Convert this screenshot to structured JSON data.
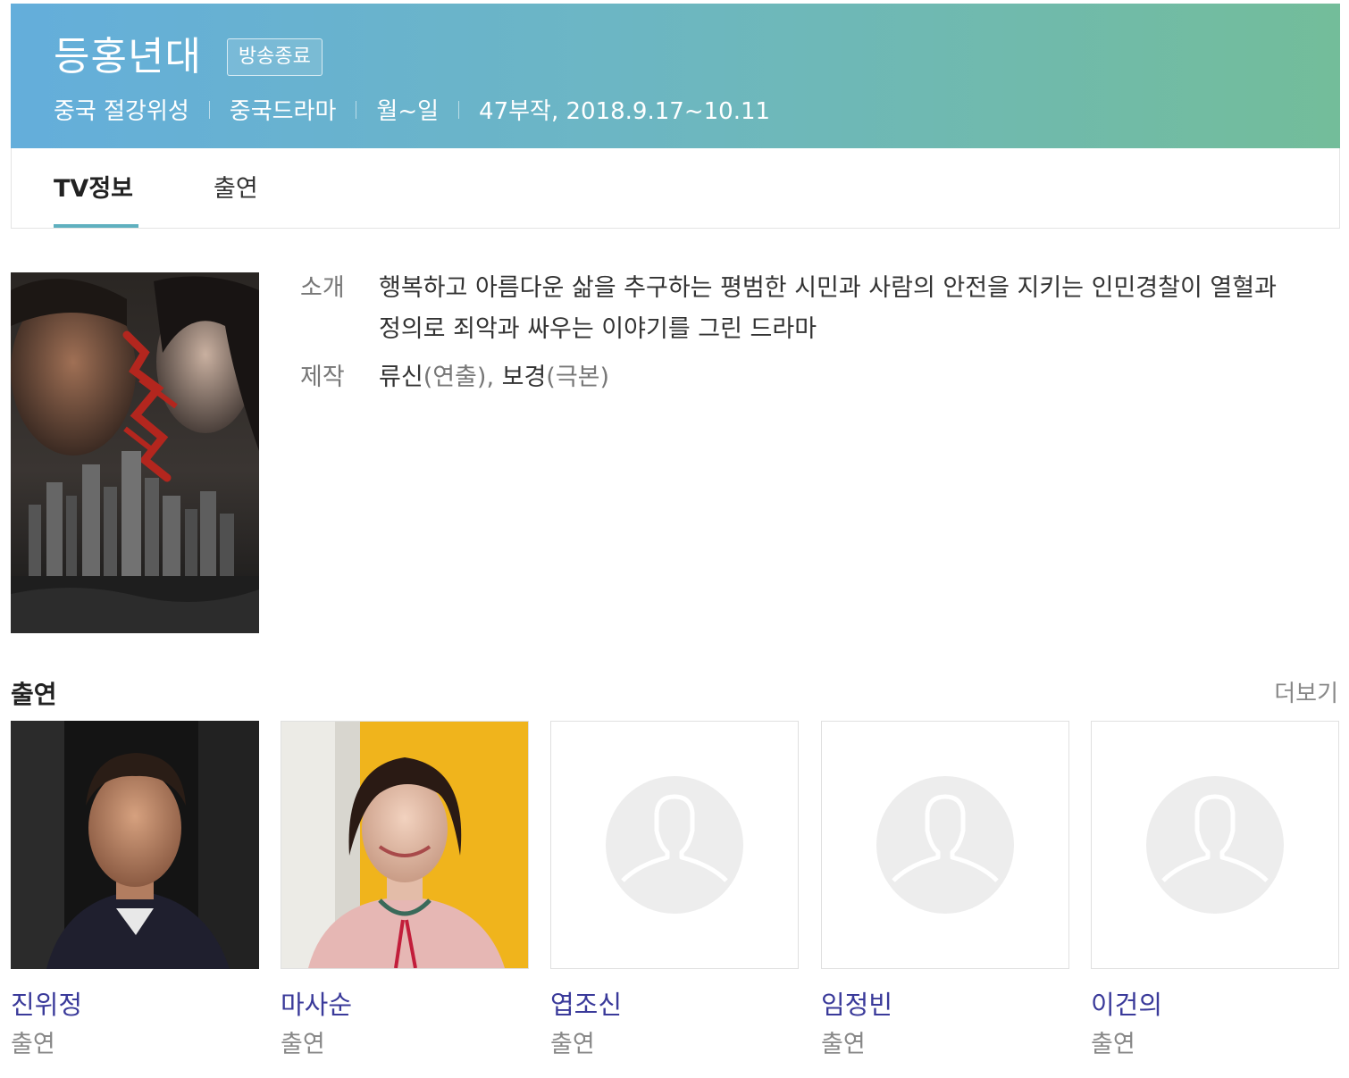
{
  "header": {
    "title": "등홍년대",
    "badge": "방송종료",
    "meta": [
      "중국 절강위성",
      "중국드라마",
      "월~일",
      "47부작, 2018.9.17~10.11"
    ]
  },
  "tabs": [
    {
      "label": "TV정보",
      "active": true
    },
    {
      "label": "출연",
      "active": false
    }
  ],
  "info": {
    "intro_label": "소개",
    "intro_text": "행복하고 아름다운 삶을 추구하는 평범한 시민과 사람의 안전을 지키는 인민경찰이 열혈과 정의로 죄악과 싸우는 이야기를 그린 드라마",
    "production_label": "제작",
    "production": [
      {
        "name": "류신",
        "role": "(연출)",
        "sep": ", "
      },
      {
        "name": "보경",
        "role": "(극본)",
        "sep": ""
      }
    ]
  },
  "cast_section": {
    "title": "출연",
    "more": "더보기",
    "members": [
      {
        "name": "진위정",
        "role": "출연",
        "photo": "photo"
      },
      {
        "name": "마사순",
        "role": "출연",
        "photo": "photo"
      },
      {
        "name": "엽조신",
        "role": "출연",
        "photo": "placeholder"
      },
      {
        "name": "임정빈",
        "role": "출연",
        "photo": "placeholder"
      },
      {
        "name": "이건의",
        "role": "출연",
        "photo": "placeholder"
      }
    ]
  },
  "colors": {
    "header_gradient_start": "#64aedb",
    "header_gradient_end": "#73bd9a",
    "tab_accent": "#5fb0bf",
    "cast_name": "#3a3a9a"
  }
}
